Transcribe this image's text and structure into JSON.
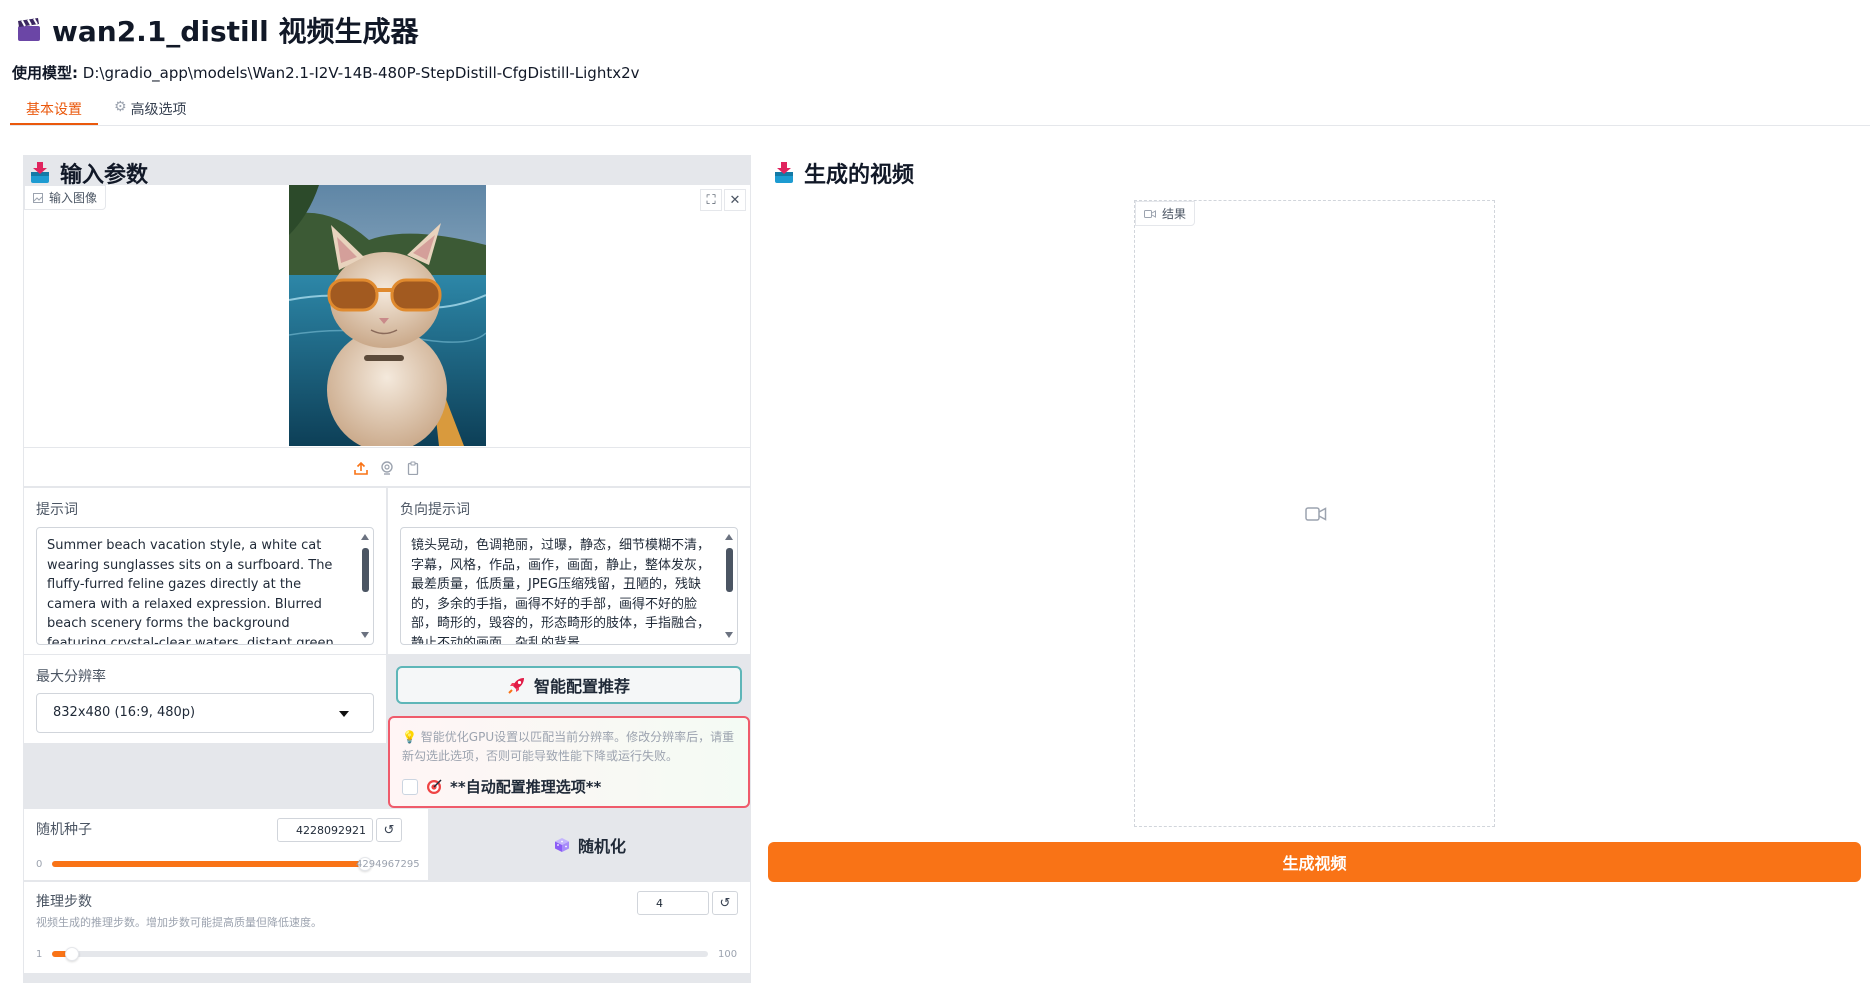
{
  "app": {
    "title": "wan2.1_distill 视频生成器",
    "model_label": "使用模型:",
    "model_path": "D:\\gradio_app\\models\\Wan2.1-I2V-14B-480P-StepDistill-CfgDistill-Lightx2v"
  },
  "tabs": [
    {
      "label": "基本设置",
      "active": true
    },
    {
      "label": "高级选项",
      "active": false,
      "icon": "gear-icon"
    }
  ],
  "input_panel": {
    "title": "输入参数",
    "image_label": "输入图像",
    "prompt_label": "提示词",
    "prompt_value": "Summer beach vacation style, a white cat wearing sunglasses sits on a surfboard. The fluffy-furred feline gazes directly at the camera with a relaxed expression. Blurred beach scenery forms the background featuring crystal-clear waters, distant green hills, and a blue sky dotted with white clouds.",
    "negative_prompt_label": "负向提示词",
    "negative_prompt_value": "镜头晃动，色调艳丽，过曝，静态，细节模糊不清，字幕，风格，作品，画作，画面，静止，整体发灰，最差质量，低质量，JPEG压缩残留，丑陋的，残缺的，多余的手指，画得不好的手部，画得不好的脸部，畸形的，毁容的，形态畸形的肢体，手指融合，静止不动的画面，杂乱的背景",
    "resolution_label": "最大分辨率",
    "resolution_value": "832x480 (16:9, 480p)",
    "smart_config_button": "智能配置推荐",
    "auto_config_tip": "智能优化GPU设置以匹配当前分辨率。修改分辨率后，请重新勾选此选项，否则可能导致性能下降或运行失败。",
    "auto_config_label": "**自动配置推理选项**",
    "seed_label": "随机种子",
    "seed_value": "4228092921",
    "seed_min": "0",
    "seed_max": "4294967295",
    "seed_fraction": 0.9844,
    "randomize_button": "随机化",
    "steps_label": "推理步数",
    "steps_info": "视频生成的推理步数。增加步数可能提高质量但降低速度。",
    "steps_value": "4",
    "steps_min": "1",
    "steps_max": "100",
    "steps_fraction": 0.0303
  },
  "output_panel": {
    "title": "生成的视频",
    "video_label": "结果",
    "generate_button": "生成视频"
  },
  "colors": {
    "accent": "#f97316",
    "smart_border": "#5eb6b8",
    "auto_border": "#ef5b6b"
  }
}
